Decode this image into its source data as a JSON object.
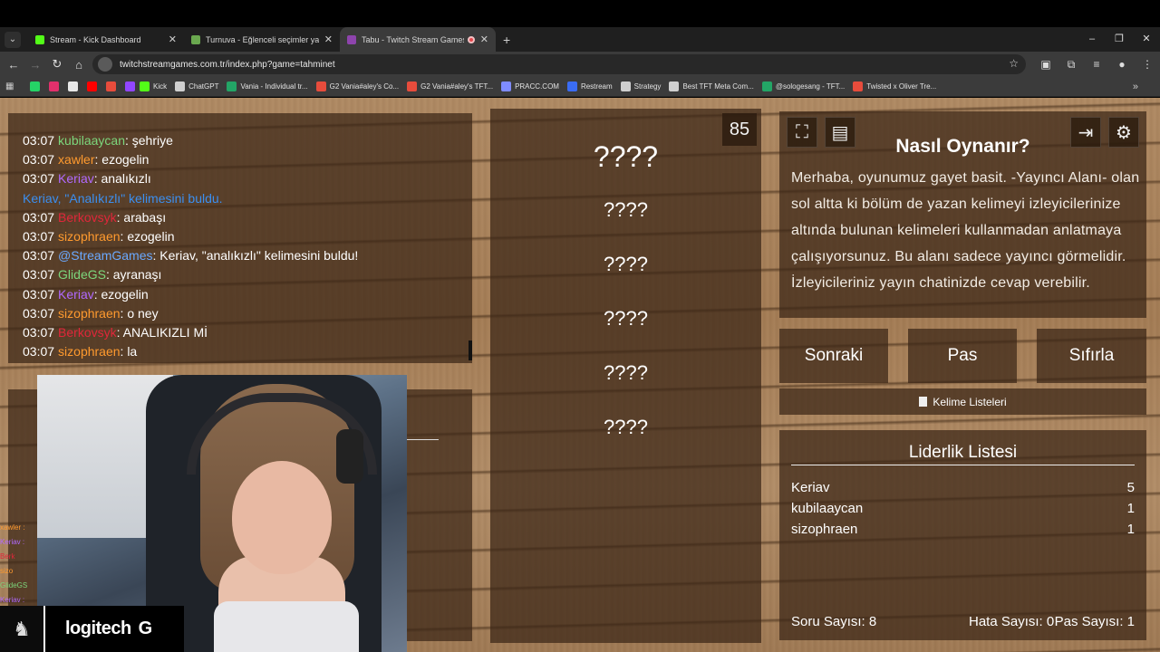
{
  "browser": {
    "tabs": [
      {
        "title": "Stream - Kick Dashboard",
        "favicon_color": "#53fc18",
        "active": false,
        "recording": false
      },
      {
        "title": "Turnuva - Eğlenceli seçimler yap",
        "favicon_color": "#6aa84f",
        "active": false,
        "recording": false
      },
      {
        "title": "Tabu - Twitch Stream Games",
        "favicon_color": "#8e44ad",
        "active": true,
        "recording": true
      }
    ],
    "url": "twitchstreamgames.com.tr/index.php?game=tahminet",
    "bookmarks": [
      {
        "label": "Kick",
        "icon_color": "#53fc18"
      },
      {
        "label": "ChatGPT",
        "icon_color": "#cfcfcf"
      },
      {
        "label": "Vania - Individual tr...",
        "icon_color": "#23a566"
      },
      {
        "label": "G2 Vania#aley's Co...",
        "icon_color": "#e74c3c"
      },
      {
        "label": "G2 Vania#aley's TFT...",
        "icon_color": "#e74c3c"
      },
      {
        "label": "PRACC.COM",
        "icon_color": "#7f8cff"
      },
      {
        "label": "Restream",
        "icon_color": "#3a6cf4"
      },
      {
        "label": "Strategy",
        "icon_color": "#cfcfcf"
      },
      {
        "label": "Best TFT Meta Com...",
        "icon_color": "#cfcfcf"
      },
      {
        "label": "@sologesang - TFT...",
        "icon_color": "#23a566"
      },
      {
        "label": "Twisted x Oliver Tre...",
        "icon_color": "#e74c3c"
      }
    ],
    "bookmark_icons": [
      "#25d366",
      "#e1306c",
      "#e8e8e8",
      "#ff0000",
      "#e74c3c",
      "#9146ff"
    ]
  },
  "chat": {
    "messages": [
      {
        "time": "03:07",
        "user": "kubilaaycan",
        "color": "#7cd67c",
        "text": ": şehriye"
      },
      {
        "time": "03:07",
        "user": "xawler",
        "color": "#ff9a2e",
        "text": ": ezogelin"
      },
      {
        "time": "03:07",
        "user": "Keriav",
        "color": "#b169ff",
        "text": ": analıkızlı"
      },
      {
        "time": "",
        "user": "Keriav, \"Analıkızlı\" kelimesini buldu.",
        "color": "#3b8ff0",
        "text": ""
      },
      {
        "time": "03:07",
        "user": "Berkovsyk",
        "color": "#e0263a",
        "text": ": arabaşı"
      },
      {
        "time": "03:07",
        "user": "sizophraen",
        "color": "#ff9a2e",
        "text": ": ezogelin"
      },
      {
        "time": "03:07",
        "user": "@StreamGames",
        "color": "#6aa9ff",
        "text": ": Keriav, \"analıkızlı\" kelimesini buldu!"
      },
      {
        "time": "03:07",
        "user": "GlideGS",
        "color": "#7cd67c",
        "text": ": ayranaşı"
      },
      {
        "time": "03:07",
        "user": "Keriav",
        "color": "#b169ff",
        "text": ": ezogelin"
      },
      {
        "time": "03:07",
        "user": "sizophraen",
        "color": "#ff9a2e",
        "text": ": o ney"
      },
      {
        "time": "03:07",
        "user": "Berkovsyk",
        "color": "#e0263a",
        "text": ": ANALIKIZLI Mİ"
      },
      {
        "time": "03:07",
        "user": "sizophraen",
        "color": "#ff9a2e",
        "text": ": la"
      }
    ]
  },
  "side_users": [
    {
      "name": "xawler :",
      "color": "#ff9a2e"
    },
    {
      "name": "Keriav :",
      "color": "#b169ff"
    },
    {
      "name": "Berk",
      "color": "#e0263a"
    },
    {
      "name": "sizo",
      "color": "#ff9a2e"
    },
    {
      "name": "GlideGS",
      "color": "#7cd67c"
    },
    {
      "name": "Keriav :",
      "color": "#b169ff"
    }
  ],
  "overlay": {
    "brand": "logitech",
    "brand_mark": "G"
  },
  "game": {
    "timer": "85",
    "main_word": "????",
    "forbidden_words": [
      "????",
      "????",
      "????",
      "????",
      "????"
    ]
  },
  "info": {
    "title": "Nasıl Oynanır?",
    "text": "Merhaba, oyunumuz gayet basit. -Yayıncı Alanı- olan sol altta ki bölüm de yazan kelimeyi izleyicilerinize altında bulunan kelimeleri kullanmadan anlatmaya çalışıyorsunuz. Bu alanı sadece yayıncı görmelidir. İzleyicileriniz yayın chatinizde cevap verebilir."
  },
  "controls": {
    "next": "Sonraki",
    "pass": "Pas",
    "reset": "Sıfırla",
    "word_lists": "Kelime Listeleri"
  },
  "leaderboard": {
    "title": "Liderlik Listesi",
    "rows": [
      {
        "name": "Keriav",
        "score": "5"
      },
      {
        "name": "kubilaaycan",
        "score": "1"
      },
      {
        "name": "sizophraen",
        "score": "1"
      }
    ],
    "question_count": "Soru Sayısı: 8",
    "error_count": "Hata Sayısı: 0",
    "pass_count": "Pas Sayısı: 1"
  }
}
